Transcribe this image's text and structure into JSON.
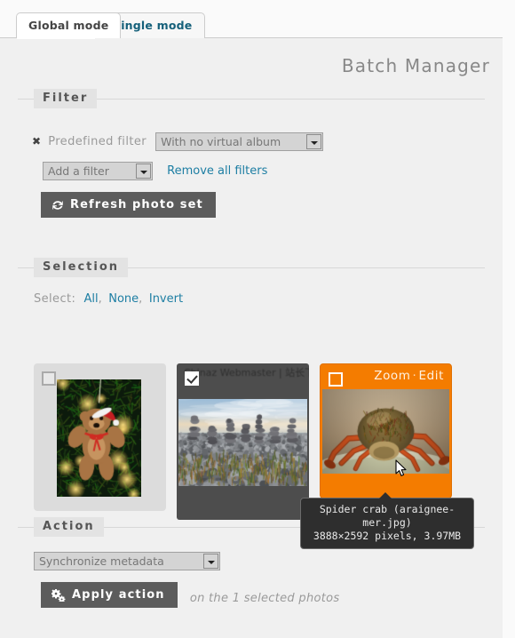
{
  "window": {
    "title": "Batch Manager"
  },
  "tabs": [
    {
      "label": "Global mode",
      "active": true
    },
    {
      "label": "Single mode",
      "active": false
    }
  ],
  "filter": {
    "legend": "Filter",
    "remove_mark": "✖",
    "predefined_label": "Predefined filter",
    "predefined_value": "With no virtual album",
    "add_filter_value": "Add a filter",
    "remove_all_label": "Remove all filters",
    "refresh_label": "Refresh photo set",
    "refresh_icon": "refresh-icon"
  },
  "selection": {
    "legend": "Selection",
    "select_label": "Select:",
    "links": [
      "All",
      "None",
      "Invert"
    ],
    "separator": ",",
    "thumbnails": [
      {
        "name": "teddy-bear-ornament",
        "checked": false,
        "hovered": false,
        "watermark": ""
      },
      {
        "name": "stone-cairns-beach",
        "checked": true,
        "hovered": false,
        "watermark": "Chinaz Webmaster | 站长下载"
      },
      {
        "name": "spider-crab",
        "checked": false,
        "hovered": true,
        "watermark": "",
        "zoom_label": "Zoom",
        "action_separator": "·",
        "edit_label": "Edit"
      }
    ]
  },
  "tooltip": {
    "line1": "Spider crab (araignee-mer.jpg)",
    "line2": "3888×2592 pixels, 3.97MB"
  },
  "action": {
    "legend": "Action",
    "select_value": "Synchronize metadata",
    "apply_label": "Apply action",
    "apply_icon": "cogs-icon",
    "note": "on the 1 selected photos"
  },
  "colors": {
    "accent_orange": "#f47c00",
    "link_blue": "#1d7ea3",
    "button_gray": "#5c5c5c",
    "page_bg": "#f0f0f0"
  }
}
